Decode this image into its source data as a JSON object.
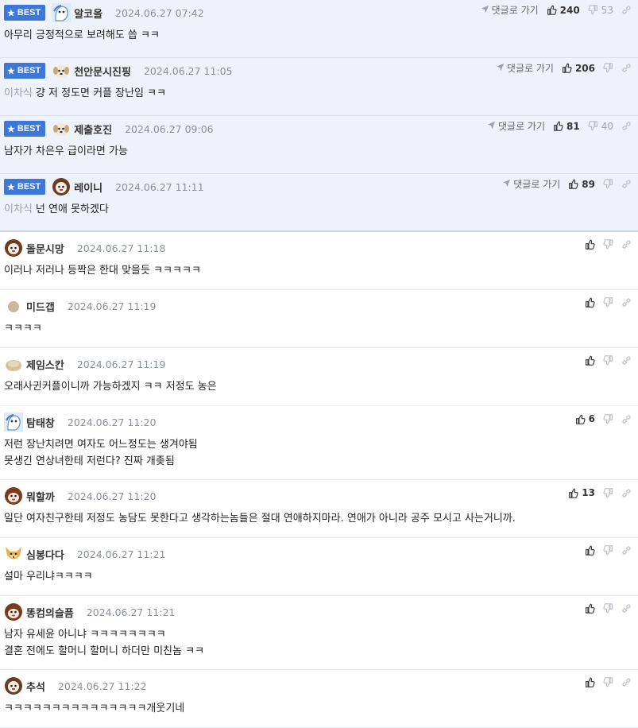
{
  "comments": [
    {
      "best": true,
      "badge": "BEST",
      "nick": "알코올",
      "avatar": "ghost",
      "time": "2024.06.27 07:42",
      "tag": "",
      "lines": [
        "아무리 긍정적으로 보려해도 씁 ㅋㅋ"
      ],
      "goto": "댓글로 가기",
      "likes": "240",
      "dislikes": "53"
    },
    {
      "best": true,
      "badge": "BEST",
      "nick": "천안문시진핑",
      "avatar": "puppy",
      "time": "2024.06.27 11:05",
      "tag": "이차식",
      "lines": [
        "걍 저 정도면 커플 장난임 ㅋㅋ"
      ],
      "goto": "댓글로 가기",
      "likes": "206",
      "dislikes": ""
    },
    {
      "best": true,
      "badge": "BEST",
      "nick": "제출호진",
      "avatar": "puppy",
      "time": "2024.06.27 09:06",
      "tag": "",
      "lines": [
        "남자가 차은우 급이라면 가능"
      ],
      "goto": "댓글로 가기",
      "likes": "81",
      "dislikes": "40"
    },
    {
      "best": true,
      "badge": "BEST",
      "nick": "레이니",
      "avatar": "lion",
      "time": "2024.06.27 11:11",
      "tag": "이차식",
      "lines": [
        "넌 연애 못하겠다"
      ],
      "goto": "댓글로 가기",
      "likes": "89",
      "dislikes": ""
    },
    {
      "best": false,
      "nick": "돌문시망",
      "avatar": "lion",
      "time": "2024.06.27 11:18",
      "tag": "",
      "lines": [
        "이러나 저러나 등짝은 한대 맞을듯 ㅋㅋㅋㅋㅋ"
      ],
      "likes": "",
      "dislikes": ""
    },
    {
      "best": false,
      "nick": "미드갭",
      "avatar": "dot",
      "time": "2024.06.27 11:19",
      "tag": "",
      "lines": [
        "ㅋㅋㅋㅋ"
      ],
      "likes": "",
      "dislikes": ""
    },
    {
      "best": false,
      "nick": "제임스칸",
      "avatar": "blob",
      "time": "2024.06.27 11:19",
      "tag": "",
      "lines": [
        "오래사귄커플이니까 가능하겠지 ㅋㅋ 저정도 농은"
      ],
      "likes": "",
      "dislikes": ""
    },
    {
      "best": false,
      "nick": "탐태창",
      "avatar": "ghost",
      "time": "2024.06.27 11:20",
      "tag": "",
      "lines": [
        "저런 장난치려면 여자도 어느정도는 생겨야됨",
        "못생긴 연상녀한테 저런다? 진짜 개좆됨"
      ],
      "likes": "6",
      "dislikes": ""
    },
    {
      "best": false,
      "nick": "뭐할까",
      "avatar": "monkey",
      "time": "2024.06.27 11:20",
      "tag": "",
      "lines": [
        "일단 여자친구한테 저정도 농담도 못한다고 생각하는놈들은 절대 연애하지마라. 연애가 아니라 공주 모시고 사는거니까."
      ],
      "likes": "13",
      "dislikes": ""
    },
    {
      "best": false,
      "nick": "심봉다다",
      "avatar": "fox",
      "time": "2024.06.27 11:21",
      "tag": "",
      "lines": [
        "설마 우리냐ㅋㅋㅋㅋ"
      ],
      "likes": "",
      "dislikes": ""
    },
    {
      "best": false,
      "nick": "똥컴의슬픔",
      "avatar": "monkey",
      "time": "2024.06.27 11:21",
      "tag": "",
      "lines": [
        "남자 유세윤 아니냐 ㅋㅋㅋㅋㅋㅋㅋㅋ",
        "결혼 전에도 할머니 할머니 하더만 미친놈 ㅋㅋ"
      ],
      "likes": "",
      "dislikes": ""
    },
    {
      "best": false,
      "nick": "추석",
      "avatar": "lion",
      "time": "2024.06.27 11:22",
      "tag": "",
      "lines": [
        "ㅋㅋㅋㅋㅋㅋㅋㅋㅋㅋㅋㅋㅋㅋㅋ개웃기네"
      ],
      "likes": "",
      "dislikes": ""
    }
  ],
  "colors": {
    "best_bg": "#eef3fb",
    "badge": "#3d77d8",
    "time": "#8a8f98"
  }
}
